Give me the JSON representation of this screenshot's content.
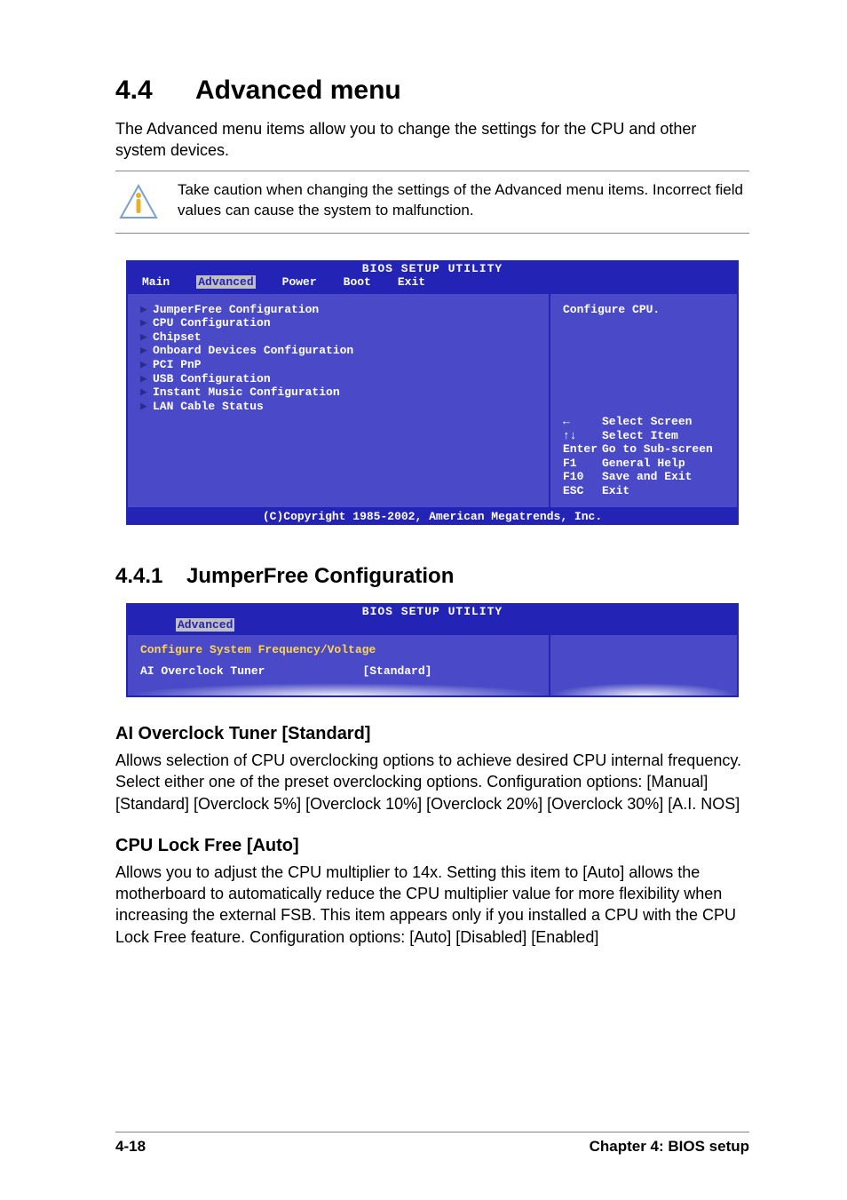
{
  "heading": {
    "num": "4.4",
    "title": "Advanced menu"
  },
  "intro": "The Advanced menu items allow you to change the settings for the CPU and other system devices.",
  "caution": "Take caution when changing the settings of the Advanced menu items. Incorrect field values can cause the system to malfunction.",
  "bios1": {
    "title": "BIOS SETUP UTILITY",
    "tabs": [
      "Main",
      "Advanced",
      "Power",
      "Boot",
      "Exit"
    ],
    "active_tab": "Advanced",
    "items": [
      "JumperFree Configuration",
      "CPU Configuration",
      "Chipset",
      "Onboard Devices Configuration",
      "PCI PnP",
      "USB Configuration",
      "Instant Music Configuration",
      "LAN Cable Status"
    ],
    "help_top": "Configure CPU.",
    "help_keys": [
      {
        "k": "←",
        "t": "Select Screen"
      },
      {
        "k": "↑↓",
        "t": "Select Item"
      },
      {
        "k": "Enter",
        "t": "Go to Sub-screen"
      },
      {
        "k": "F1",
        "t": "General Help"
      },
      {
        "k": "F10",
        "t": "Save and Exit"
      },
      {
        "k": "ESC",
        "t": "Exit"
      }
    ],
    "copyright": "(C)Copyright 1985-2002, American Megatrends, Inc."
  },
  "subsection": {
    "num": "4.4.1",
    "title": "JumperFree Configuration"
  },
  "bios2": {
    "title": "BIOS SETUP UTILITY",
    "active_tab": "Advanced",
    "line1": "Configure System Frequency/Voltage",
    "opt_label": "AI Overclock Tuner",
    "opt_value": "[Standard]"
  },
  "opt1": {
    "heading": "AI Overclock Tuner [Standard]",
    "body": "Allows selection of CPU overclocking options to achieve desired CPU internal frequency. Select either one of the preset overclocking options. Configuration options: [Manual] [Standard] [Overclock 5%] [Overclock 10%] [Overclock 20%] [Overclock 30%] [A.I. NOS]"
  },
  "opt2": {
    "heading": "CPU Lock Free [Auto]",
    "body": "Allows you to adjust the CPU multiplier to 14x. Setting this item to [Auto] allows the motherboard to automatically reduce the CPU multiplier value for more flexibility when increasing the external FSB. This item appears only if you installed a CPU with the CPU Lock Free feature. Configuration options: [Auto] [Disabled] [Enabled]"
  },
  "footer": {
    "page": "4-18",
    "chapter": "Chapter 4: BIOS setup"
  }
}
